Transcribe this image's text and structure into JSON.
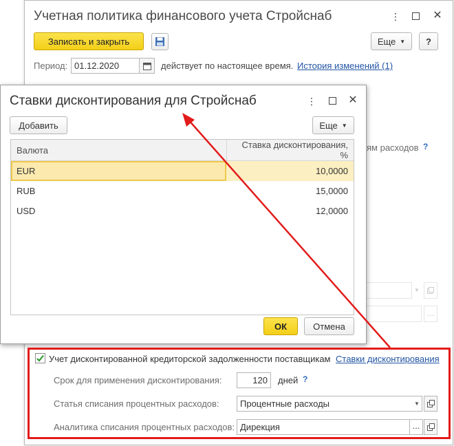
{
  "main_window": {
    "title": "Учетная политика финансового учета Стройснаб",
    "toolbar": {
      "save_close_label": "Записать и закрыть",
      "more_label": "Еще",
      "help_label": "?"
    },
    "period": {
      "label": "Период:",
      "value": "01.12.2020",
      "status_text": "действует по настоящее время.",
      "history_link": "История изменений (1)"
    },
    "partial_text": "ям расходов",
    "partial_help": "?"
  },
  "dialog": {
    "title": "Ставки дисконтирования для Стройснаб",
    "add_label": "Добавить",
    "more_label": "Еще",
    "columns": [
      "Валюта",
      "Ставка дисконтирования, %"
    ],
    "rows": [
      {
        "currency": "EUR",
        "rate": "10,0000"
      },
      {
        "currency": "RUB",
        "rate": "15,0000"
      },
      {
        "currency": "USD",
        "rate": "12,0000"
      }
    ],
    "ok_label": "ОК",
    "cancel_label": "Отмена"
  },
  "discount_section": {
    "checkbox_label": "Учет дисконтированной кредиторской задолженности поставщикам",
    "checked": true,
    "rates_link": "Ставки дисконтирования",
    "term_label": "Срок для применения дисконтирования:",
    "term_value": "120",
    "term_unit": "дней",
    "term_help": "?",
    "expense_item_label": "Статья списания процентных расходов:",
    "expense_item_value": "Процентные расходы",
    "analytics_label": "Аналитика списания процентных расходов:",
    "analytics_value": "Дирекция"
  },
  "colors": {
    "highlight": "#e21b1b",
    "primary_button": "#f3cf18",
    "link": "#2255a4",
    "selected_row": "#fcefc1"
  }
}
